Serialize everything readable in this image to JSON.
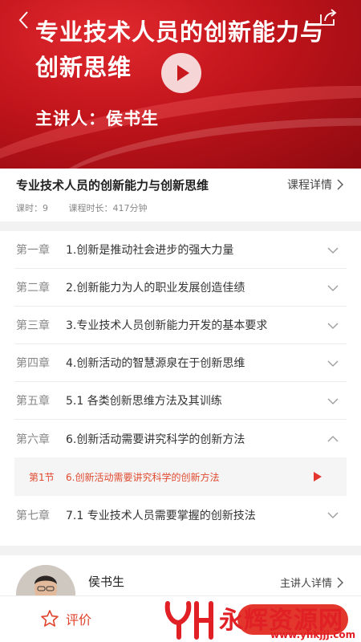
{
  "banner": {
    "title": "专业技术人员的创新能力与创新思维",
    "lecturer_line": "主讲人：侯书生"
  },
  "course": {
    "title": "专业技术人员的创新能力与创新思维",
    "detail_label": "课程详情",
    "hours": "课时：9",
    "duration": "课程时长：417分钟"
  },
  "chapters": [
    {
      "no": "第一章",
      "title": "1.创新是推动社会进步的强大力量"
    },
    {
      "no": "第二章",
      "title": "2.创新能力为人的职业发展创造佳绩"
    },
    {
      "no": "第三章",
      "title": "3.专业技术人员创新能力开发的基本要求"
    },
    {
      "no": "第四章",
      "title": "4.创新活动的智慧源泉在于创新思维"
    },
    {
      "no": "第五章",
      "title": "5.1  各类创新思维方法及其训练"
    },
    {
      "no": "第六章",
      "title": "6.创新活动需要讲究科学的创新方法"
    },
    {
      "no": "第七章",
      "title": "7.1 专业技术人员需要掌握的创新技法"
    }
  ],
  "expanded_section": {
    "no": "第1节",
    "title": "6.创新活动需要讲究科学的创新方法"
  },
  "lecturer": {
    "name": "侯书生",
    "detail_label": "主讲人详情"
  },
  "bottom": {
    "rate_label": "评价"
  },
  "watermark": {
    "text": "永辉资源网",
    "url": "www.yhkjjj.com"
  },
  "colors": {
    "accent": "#e3362c",
    "banner_red": "#c1141b"
  }
}
